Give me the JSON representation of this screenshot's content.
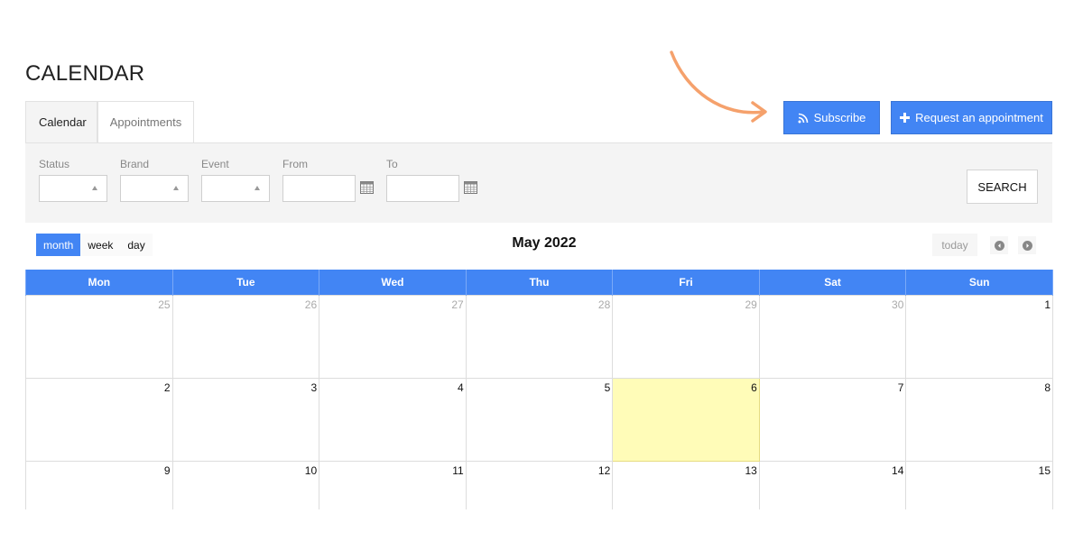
{
  "page": {
    "title": "CALENDAR"
  },
  "tabs": [
    {
      "label": "Calendar",
      "active": true
    },
    {
      "label": "Appointments",
      "active": false
    }
  ],
  "actions": {
    "subscribe_label": "Subscribe",
    "subscribe_icon": "rss-icon",
    "request_label": "Request an appointment",
    "request_icon": "plus-icon",
    "accent_color": "#4285f4"
  },
  "filters": {
    "status_label": "Status",
    "brand_label": "Brand",
    "event_label": "Event",
    "from_label": "From",
    "to_label": "To",
    "from_value": "",
    "to_value": "",
    "search_label": "SEARCH"
  },
  "toolbar": {
    "views": [
      {
        "label": "month",
        "active": true
      },
      {
        "label": "week",
        "active": false
      },
      {
        "label": "day",
        "active": false
      }
    ],
    "month_title": "May 2022",
    "today_label": "today"
  },
  "calendar": {
    "weekdays": [
      "Mon",
      "Tue",
      "Wed",
      "Thu",
      "Fri",
      "Sat",
      "Sun"
    ],
    "weeks": [
      [
        "25",
        "26",
        "27",
        "28",
        "29",
        "30",
        "1"
      ],
      [
        "2",
        "3",
        "4",
        "5",
        "6",
        "7",
        "8"
      ],
      [
        "9",
        "10",
        "11",
        "12",
        "13",
        "14",
        "15"
      ]
    ],
    "today": "6",
    "today_color": "#fffcb8"
  }
}
